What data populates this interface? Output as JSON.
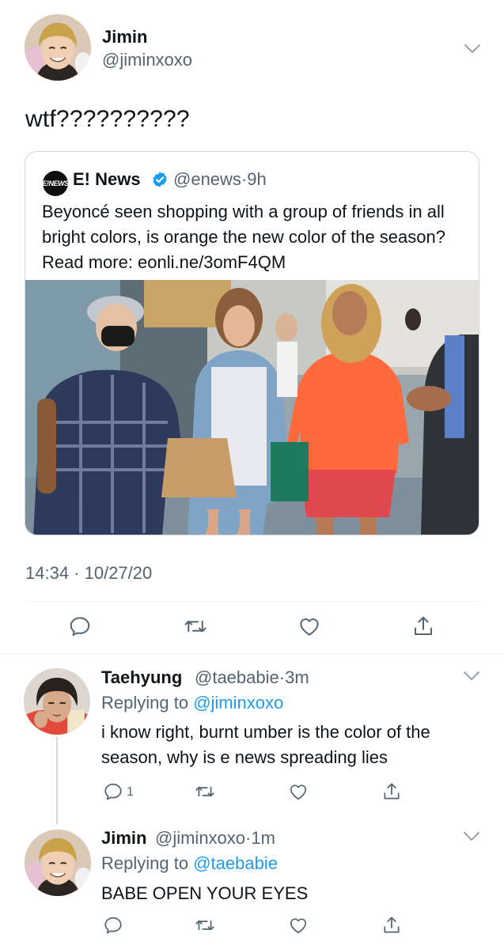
{
  "main_tweet": {
    "author_name": "Jimin",
    "author_handle": "@jiminxoxo",
    "text": "wtf??????????",
    "timestamp": "14:34 · 10/27/20",
    "quote": {
      "logo_text": "E!NEWS",
      "name": "E! News",
      "handle": "@enews",
      "separator": "·",
      "time": "9h",
      "text": "Beyoncé seen shopping with a group of friends in all bright colors, is orange the new color of the season? Read more: eonli.ne/3omF4QM"
    }
  },
  "replies": [
    {
      "author_name": "Taehyung",
      "author_handle": "@taebabie",
      "separator": "·",
      "time": "3m",
      "replying_label": "Replying to",
      "replying_to": "@jiminxoxo",
      "text": "i know right, burnt umber is the color of the season, why is e news spreading lies",
      "reply_count": "1"
    },
    {
      "author_name": "Jimin",
      "author_handle": "@jiminxoxo",
      "separator": "·",
      "time": "1m",
      "replying_label": "Replying to",
      "replying_to": "@taebabie",
      "text": "BABE OPEN YOUR EYES",
      "reply_count": ""
    }
  ],
  "icons": {
    "reply": "reply-icon",
    "retweet": "retweet-icon",
    "like": "heart-icon",
    "share": "share-icon",
    "more": "chevron-down-icon",
    "verified": "verified-badge-icon"
  },
  "colors": {
    "accent": "#1d9bf0",
    "text_primary": "#0f1419",
    "text_secondary": "#536471",
    "border": "#cfd9de"
  }
}
